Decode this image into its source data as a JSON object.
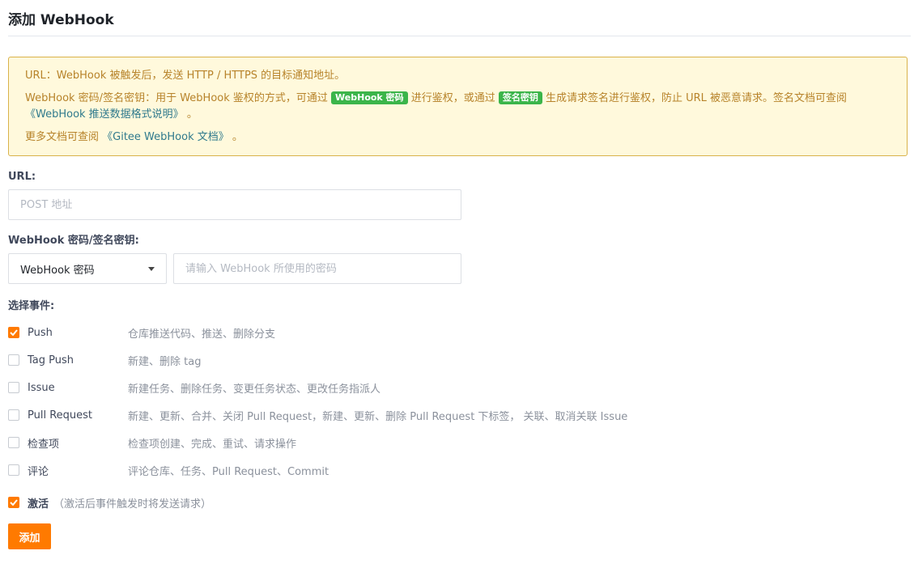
{
  "page": {
    "title": "添加 WebHook"
  },
  "notice": {
    "line1": "URL：WebHook 被触发后，发送 HTTP / HTTPS 的目标通知地址。",
    "line2_a": "WebHook 密码/签名密钥：用于 WebHook 鉴权的方式，可通过 ",
    "badge_password": "WebHook 密码",
    "line2_b": " 进行鉴权，或通过 ",
    "badge_signature": "签名密钥",
    "line2_c": " 生成请求签名进行鉴权，防止 URL 被恶意请求。签名文档可查阅",
    "link_format": "《WebHook 推送数据格式说明》",
    "line2_end": " 。",
    "line3_a": "更多文档可查阅 ",
    "link_docs": "《Gitee WebHook 文档》",
    "line3_end": " 。"
  },
  "url_field": {
    "label": "URL:",
    "placeholder": "POST 地址",
    "value": ""
  },
  "secret_field": {
    "label": "WebHook 密码/签名密钥:",
    "selected": "WebHook 密码",
    "placeholder": "请输入 WebHook 所使用的密码",
    "value": ""
  },
  "events": {
    "label": "选择事件:",
    "items": [
      {
        "name": "Push",
        "desc": "仓库推送代码、推送、删除分支",
        "checked": true
      },
      {
        "name": "Tag Push",
        "desc": "新建、删除 tag",
        "checked": false
      },
      {
        "name": "Issue",
        "desc": "新建任务、删除任务、变更任务状态、更改任务指派人",
        "checked": false
      },
      {
        "name": "Pull Request",
        "desc": "新建、更新、合并、关闭 Pull Request，新建、更新、删除 Pull Request 下标签， 关联、取消关联 Issue",
        "checked": false
      },
      {
        "name": "检查项",
        "desc": "检查项创建、完成、重试、请求操作",
        "checked": false
      },
      {
        "name": "评论",
        "desc": "评论仓库、任务、Pull Request、Commit",
        "checked": false
      }
    ]
  },
  "activate": {
    "label": "激活",
    "hint": "（激活后事件触发时将发送请求）",
    "checked": true
  },
  "submit": {
    "label": "添加"
  },
  "colors": {
    "accent": "#ff7a00",
    "notice_bg": "#fff9dc",
    "notice_border": "#d9b24a",
    "badge_green": "#3bb54a"
  }
}
